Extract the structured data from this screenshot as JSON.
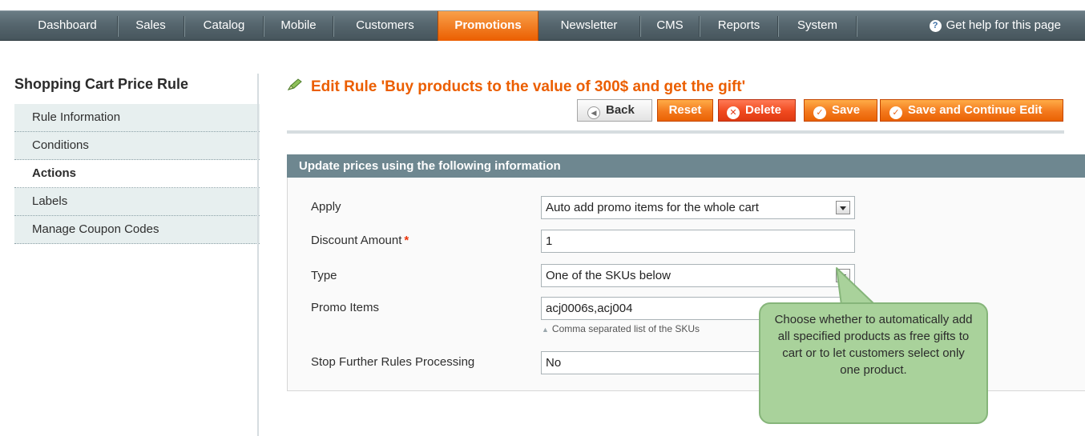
{
  "nav": {
    "items": [
      "Dashboard",
      "Sales",
      "Catalog",
      "Mobile",
      "Customers",
      "Promotions",
      "Newsletter",
      "CMS",
      "Reports",
      "System"
    ],
    "active": "Promotions",
    "help_label": "Get help for this page",
    "help_icon": "question-circle-icon"
  },
  "sidebar": {
    "title": "Shopping Cart Price Rule",
    "items": [
      {
        "label": "Rule Information"
      },
      {
        "label": "Conditions"
      },
      {
        "label": "Actions"
      },
      {
        "label": "Labels"
      },
      {
        "label": "Manage Coupon Codes"
      }
    ],
    "active": "Actions"
  },
  "header": {
    "title": "Edit Rule 'Buy products to the value of 300$ and get the gift'",
    "title_icon": "edit-pencil-icon"
  },
  "toolbar": {
    "back_label": "Back",
    "reset_label": "Reset",
    "delete_label": "Delete",
    "save_label": "Save",
    "save_continue_label": "Save and Continue Edit"
  },
  "form": {
    "section_title": "Update prices using the following information",
    "apply": {
      "label": "Apply",
      "value": "Auto add promo items for the whole cart"
    },
    "discount_amount": {
      "label": "Discount Amount",
      "required_mark": "*",
      "value": "1"
    },
    "type": {
      "label": "Type",
      "value": "One of the SKUs below"
    },
    "promo_items": {
      "label": "Promo Items",
      "value": "acj0006s,acj004",
      "note": "Comma separated list of the SKUs"
    },
    "stop_processing": {
      "label": "Stop Further Rules Processing",
      "value": "No"
    }
  },
  "callout": {
    "text": "Choose whether to automatically add all specified products as free gifts to cart or to let customers select only one product."
  },
  "colors": {
    "accent": "#eb5e00",
    "nav_bg": "#56666e",
    "section_header": "#6e8790",
    "callout_bg": "#a9d29b"
  }
}
